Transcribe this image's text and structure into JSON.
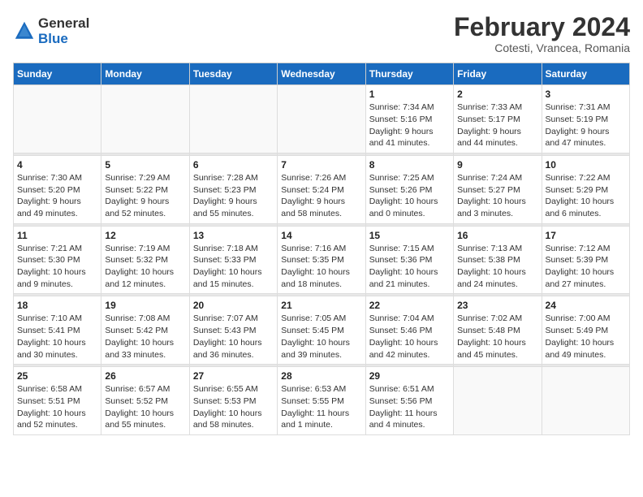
{
  "logo": {
    "general": "General",
    "blue": "Blue"
  },
  "title": "February 2024",
  "location": "Cotesti, Vrancea, Romania",
  "days_of_week": [
    "Sunday",
    "Monday",
    "Tuesday",
    "Wednesday",
    "Thursday",
    "Friday",
    "Saturday"
  ],
  "weeks": [
    [
      {
        "day": "",
        "info": ""
      },
      {
        "day": "",
        "info": ""
      },
      {
        "day": "",
        "info": ""
      },
      {
        "day": "",
        "info": ""
      },
      {
        "day": "1",
        "info": "Sunrise: 7:34 AM\nSunset: 5:16 PM\nDaylight: 9 hours\nand 41 minutes."
      },
      {
        "day": "2",
        "info": "Sunrise: 7:33 AM\nSunset: 5:17 PM\nDaylight: 9 hours\nand 44 minutes."
      },
      {
        "day": "3",
        "info": "Sunrise: 7:31 AM\nSunset: 5:19 PM\nDaylight: 9 hours\nand 47 minutes."
      }
    ],
    [
      {
        "day": "4",
        "info": "Sunrise: 7:30 AM\nSunset: 5:20 PM\nDaylight: 9 hours\nand 49 minutes."
      },
      {
        "day": "5",
        "info": "Sunrise: 7:29 AM\nSunset: 5:22 PM\nDaylight: 9 hours\nand 52 minutes."
      },
      {
        "day": "6",
        "info": "Sunrise: 7:28 AM\nSunset: 5:23 PM\nDaylight: 9 hours\nand 55 minutes."
      },
      {
        "day": "7",
        "info": "Sunrise: 7:26 AM\nSunset: 5:24 PM\nDaylight: 9 hours\nand 58 minutes."
      },
      {
        "day": "8",
        "info": "Sunrise: 7:25 AM\nSunset: 5:26 PM\nDaylight: 10 hours\nand 0 minutes."
      },
      {
        "day": "9",
        "info": "Sunrise: 7:24 AM\nSunset: 5:27 PM\nDaylight: 10 hours\nand 3 minutes."
      },
      {
        "day": "10",
        "info": "Sunrise: 7:22 AM\nSunset: 5:29 PM\nDaylight: 10 hours\nand 6 minutes."
      }
    ],
    [
      {
        "day": "11",
        "info": "Sunrise: 7:21 AM\nSunset: 5:30 PM\nDaylight: 10 hours\nand 9 minutes."
      },
      {
        "day": "12",
        "info": "Sunrise: 7:19 AM\nSunset: 5:32 PM\nDaylight: 10 hours\nand 12 minutes."
      },
      {
        "day": "13",
        "info": "Sunrise: 7:18 AM\nSunset: 5:33 PM\nDaylight: 10 hours\nand 15 minutes."
      },
      {
        "day": "14",
        "info": "Sunrise: 7:16 AM\nSunset: 5:35 PM\nDaylight: 10 hours\nand 18 minutes."
      },
      {
        "day": "15",
        "info": "Sunrise: 7:15 AM\nSunset: 5:36 PM\nDaylight: 10 hours\nand 21 minutes."
      },
      {
        "day": "16",
        "info": "Sunrise: 7:13 AM\nSunset: 5:38 PM\nDaylight: 10 hours\nand 24 minutes."
      },
      {
        "day": "17",
        "info": "Sunrise: 7:12 AM\nSunset: 5:39 PM\nDaylight: 10 hours\nand 27 minutes."
      }
    ],
    [
      {
        "day": "18",
        "info": "Sunrise: 7:10 AM\nSunset: 5:41 PM\nDaylight: 10 hours\nand 30 minutes."
      },
      {
        "day": "19",
        "info": "Sunrise: 7:08 AM\nSunset: 5:42 PM\nDaylight: 10 hours\nand 33 minutes."
      },
      {
        "day": "20",
        "info": "Sunrise: 7:07 AM\nSunset: 5:43 PM\nDaylight: 10 hours\nand 36 minutes."
      },
      {
        "day": "21",
        "info": "Sunrise: 7:05 AM\nSunset: 5:45 PM\nDaylight: 10 hours\nand 39 minutes."
      },
      {
        "day": "22",
        "info": "Sunrise: 7:04 AM\nSunset: 5:46 PM\nDaylight: 10 hours\nand 42 minutes."
      },
      {
        "day": "23",
        "info": "Sunrise: 7:02 AM\nSunset: 5:48 PM\nDaylight: 10 hours\nand 45 minutes."
      },
      {
        "day": "24",
        "info": "Sunrise: 7:00 AM\nSunset: 5:49 PM\nDaylight: 10 hours\nand 49 minutes."
      }
    ],
    [
      {
        "day": "25",
        "info": "Sunrise: 6:58 AM\nSunset: 5:51 PM\nDaylight: 10 hours\nand 52 minutes."
      },
      {
        "day": "26",
        "info": "Sunrise: 6:57 AM\nSunset: 5:52 PM\nDaylight: 10 hours\nand 55 minutes."
      },
      {
        "day": "27",
        "info": "Sunrise: 6:55 AM\nSunset: 5:53 PM\nDaylight: 10 hours\nand 58 minutes."
      },
      {
        "day": "28",
        "info": "Sunrise: 6:53 AM\nSunset: 5:55 PM\nDaylight: 11 hours\nand 1 minute."
      },
      {
        "day": "29",
        "info": "Sunrise: 6:51 AM\nSunset: 5:56 PM\nDaylight: 11 hours\nand 4 minutes."
      },
      {
        "day": "",
        "info": ""
      },
      {
        "day": "",
        "info": ""
      }
    ]
  ]
}
